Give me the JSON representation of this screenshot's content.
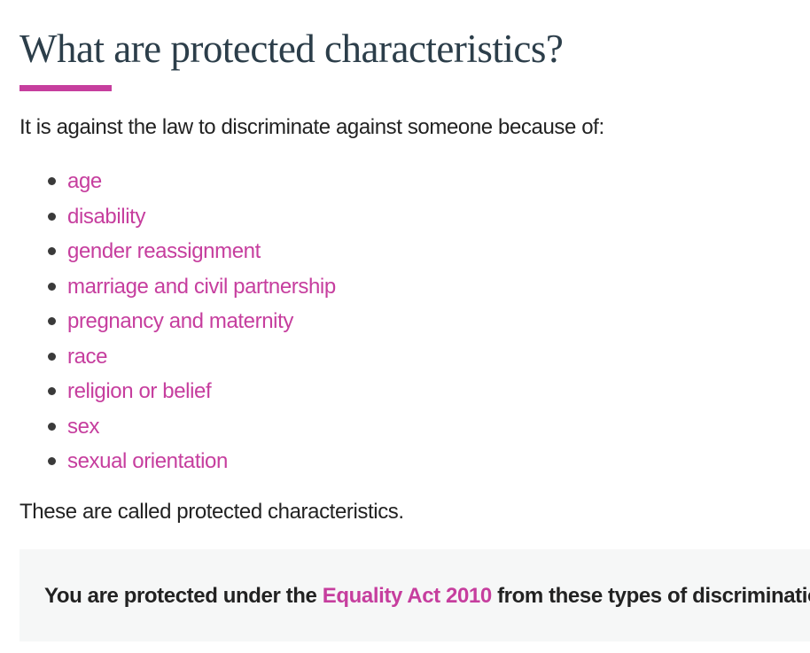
{
  "heading": {
    "title": "What are protected characteristics?",
    "accent_color": "#c63e9e",
    "title_color": "#2c3e4a"
  },
  "intro_text": "It is against the law to discriminate against someone because of:",
  "characteristics": [
    {
      "label": "age"
    },
    {
      "label": "disability"
    },
    {
      "label": "gender reassignment"
    },
    {
      "label": "marriage and civil partnership"
    },
    {
      "label": "pregnancy and maternity"
    },
    {
      "label": "race"
    },
    {
      "label": "religion or belief"
    },
    {
      "label": "sex"
    },
    {
      "label": "sexual orientation"
    }
  ],
  "outro_text": "These are called protected characteristics.",
  "callout": {
    "before_link": "You are protected under the ",
    "link_label": "Equality Act 2010",
    "after_link": " from these types of discrimination.",
    "background_color": "#f6f7f7"
  }
}
